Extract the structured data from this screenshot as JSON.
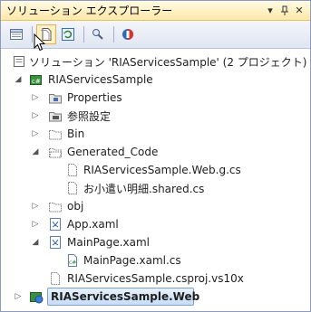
{
  "window": {
    "title": "ソリューション エクスプローラー",
    "pin_icon": "pin-icon",
    "close_icon": "close-icon",
    "dropdown_icon": "dropdown-icon"
  },
  "toolbar": {
    "buttons": [
      {
        "name": "properties-button",
        "icon": "properties-icon"
      },
      {
        "name": "show-all-files-button",
        "icon": "show-all-files-icon"
      },
      {
        "name": "refresh-button",
        "icon": "refresh-icon"
      },
      {
        "name": "view-class-diagram-button",
        "icon": "class-diagram-icon"
      },
      {
        "name": "wcf-ria-button",
        "icon": "ria-icon"
      }
    ]
  },
  "tree": {
    "solution": "ソリューション 'RIAServicesSample' (2 プロジェクト)",
    "project": "RIAServicesSample",
    "items": {
      "properties": "Properties",
      "references": "参照設定",
      "bin": "Bin",
      "generated_code": "Generated_Code",
      "web_g_cs": "RIAServicesSample.Web.g.cs",
      "shared_cs": "お小遣い明細.shared.cs",
      "obj": "obj",
      "app_xaml": "App.xaml",
      "mainpage_xaml": "MainPage.xaml",
      "mainpage_xaml_cs": "MainPage.xaml.cs",
      "csproj": "RIAServicesSample.csproj.vs10x",
      "web_project": "RIAServicesSample.Web"
    }
  }
}
